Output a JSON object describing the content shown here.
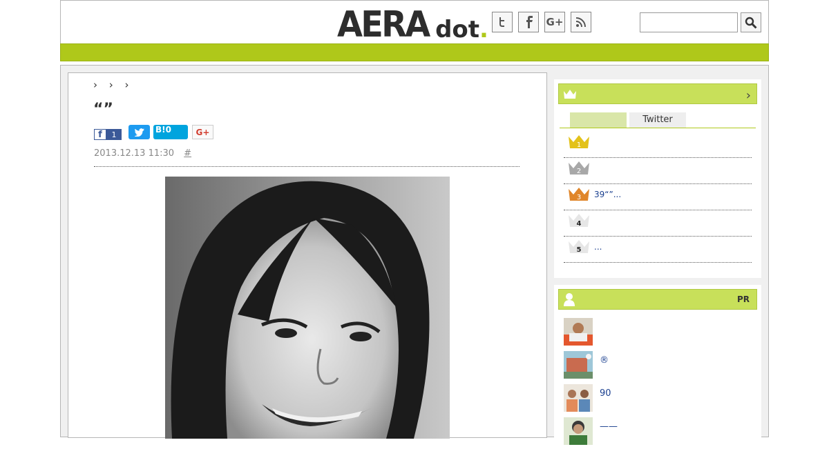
{
  "header": {
    "logo_text": "AERA",
    "logo_suffix": "dot",
    "logo_period": ".",
    "search_placeholder": "",
    "social": [
      {
        "icon": "twitter-icon",
        "glyph": "t"
      },
      {
        "icon": "facebook-icon",
        "glyph": "f"
      },
      {
        "icon": "google-plus-icon",
        "glyph": "G+"
      },
      {
        "icon": "rss-icon",
        "glyph": "rss"
      }
    ]
  },
  "article": {
    "breadcrumb": "› › ›",
    "title": "“”",
    "share": {
      "facebook_count": "1",
      "hatena_label": "B!",
      "hatena_count": "0",
      "googleplus_label": "G+"
    },
    "date": "2013.12.13 11:30",
    "hash_link": "#"
  },
  "ranking": {
    "tab_a": "",
    "tab_b": "Twitter",
    "items": [
      {
        "rank": "1",
        "text": ""
      },
      {
        "rank": "2",
        "text": ""
      },
      {
        "rank": "3",
        "text": "39“”..."
      },
      {
        "rank": "4",
        "text": ""
      },
      {
        "rank": "5",
        "text": "..."
      }
    ]
  },
  "pr_panel": {
    "label": "PR",
    "items": [
      {
        "text": ""
      },
      {
        "text": "®"
      },
      {
        "text": "90"
      },
      {
        "text": "——"
      }
    ]
  },
  "colors": {
    "brand_green": "#afc81a",
    "panel_green": "#c8e05a",
    "link_blue": "#1a3f8f"
  }
}
